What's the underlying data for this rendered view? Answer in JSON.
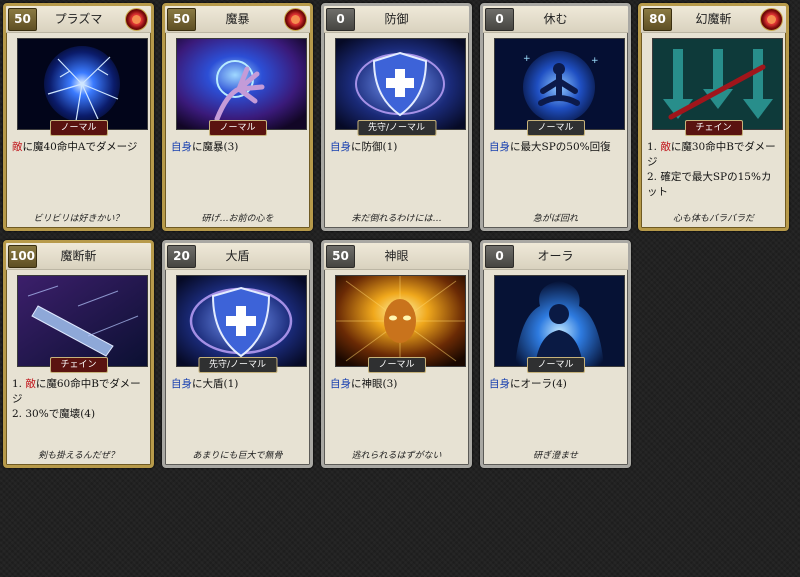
{
  "cards": [
    {
      "cost": "50",
      "name": "プラズマ",
      "tag": "ノーマル",
      "tag_style": "red",
      "frame": "gold",
      "emblem": true,
      "lines": [
        {
          "kw": "敵",
          "kw_type": "enemy",
          "text": "に魔40命中Aでダメージ"
        }
      ],
      "flavor": "ビリビリは好きかい？",
      "art": "plasma"
    },
    {
      "cost": "50",
      "name": "魔暴",
      "tag": "ノーマル",
      "tag_style": "red",
      "frame": "gold",
      "emblem": true,
      "lines": [
        {
          "kw": "自身",
          "kw_type": "self",
          "text": "に魔暴(3)"
        }
      ],
      "flavor": "研げ…お前の心を",
      "art": "hand"
    },
    {
      "cost": "0",
      "name": "防御",
      "tag": "先守/ノーマル",
      "tag_style": "dark",
      "frame": "gray",
      "emblem": false,
      "lines": [
        {
          "kw": "自身",
          "kw_type": "self",
          "text": "に防御(1)"
        }
      ],
      "flavor": "未だ倒れるわけには…",
      "art": "shield"
    },
    {
      "cost": "0",
      "name": "休む",
      "tag": "ノーマル",
      "tag_style": "dark",
      "frame": "gray",
      "emblem": false,
      "lines": [
        {
          "kw": "自身",
          "kw_type": "self",
          "text": "に最大SPの50%回復"
        }
      ],
      "flavor": "急がば回れ",
      "art": "meditate"
    },
    {
      "cost": "80",
      "name": "幻魔斬",
      "tag": "チェイン",
      "tag_style": "red",
      "frame": "gold",
      "emblem": true,
      "lines": [
        {
          "kw": "",
          "kw_type": "",
          "prefix": "1. ",
          "kw2": "敵",
          "text": "に魔30命中Bでダメージ"
        },
        {
          "kw": "",
          "kw_type": "",
          "prefix": "2. ",
          "kw2": "",
          "text": "確定で最大SPの15%カット"
        }
      ],
      "flavor": "心も体もバラバラだ",
      "art": "slash"
    },
    {
      "cost": "100",
      "name": "魔断斬",
      "tag": "チェイン",
      "tag_style": "red",
      "frame": "gold",
      "emblem": false,
      "lines": [
        {
          "kw": "",
          "kw_type": "",
          "prefix": "1. ",
          "kw2": "敵",
          "text": "に魔60命中Bでダメージ"
        },
        {
          "kw": "",
          "kw_type": "",
          "prefix": "2. ",
          "kw2": "",
          "text": "30%で魔壊(4)"
        }
      ],
      "flavor": "剣も掛えるんだぜ？",
      "art": "sword"
    },
    {
      "cost": "20",
      "name": "大盾",
      "tag": "先守/ノーマル",
      "tag_style": "dark",
      "frame": "gray",
      "emblem": false,
      "lines": [
        {
          "kw": "自身",
          "kw_type": "self",
          "text": "に大盾(1)"
        }
      ],
      "flavor": "あまりにも巨大で無骨",
      "art": "shield"
    },
    {
      "cost": "50",
      "name": "神眼",
      "tag": "ノーマル",
      "tag_style": "dark",
      "frame": "gray",
      "emblem": false,
      "lines": [
        {
          "kw": "自身",
          "kw_type": "self",
          "text": "に神眼(3)"
        }
      ],
      "flavor": "逃れられるはずがない",
      "art": "eye"
    },
    {
      "cost": "0",
      "name": "オーラ",
      "tag": "ノーマル",
      "tag_style": "dark",
      "frame": "gray",
      "emblem": false,
      "lines": [
        {
          "kw": "自身",
          "kw_type": "self",
          "text": "にオーラ(4)"
        }
      ],
      "flavor": "研ぎ澄ませ",
      "art": "aura"
    }
  ]
}
